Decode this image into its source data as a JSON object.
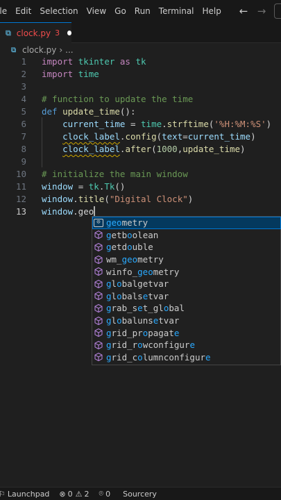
{
  "menu": [
    "File",
    "Edit",
    "Selection",
    "View",
    "Go",
    "Run",
    "Terminal",
    "Help"
  ],
  "nav": {
    "back_icon": "arrow-left-icon",
    "forward_icon": "arrow-right-icon"
  },
  "tab": {
    "filename": "clock.py",
    "problem_count": "3",
    "modified_icon": "unsaved-dot-icon"
  },
  "breadcrumb": {
    "file": "clock.py",
    "separator": "›",
    "more": "..."
  },
  "editor": {
    "line_numbers": [
      "1",
      "2",
      "3",
      "4",
      "5",
      "6",
      "7",
      "8",
      "9",
      "10",
      "11",
      "12",
      "13"
    ],
    "active_line": "13"
  },
  "suggest": {
    "items": [
      {
        "label": "geometry",
        "kind": "selected"
      },
      {
        "label": "getboolean",
        "kind": "method-icon"
      },
      {
        "label": "getdouble",
        "kind": "method-icon"
      },
      {
        "label": "wm_geometry",
        "kind": "method-icon"
      },
      {
        "label": "winfo_geometry",
        "kind": "method-icon"
      },
      {
        "label": "globalgetvar",
        "kind": "method-icon"
      },
      {
        "label": "globalsetvar",
        "kind": "method-icon"
      },
      {
        "label": "grab_set_global",
        "kind": "method-icon"
      },
      {
        "label": "globalunsetvar",
        "kind": "method-icon"
      },
      {
        "label": "grid_propagate",
        "kind": "method-icon"
      },
      {
        "label": "grid_rowconfigure",
        "kind": "method-icon"
      },
      {
        "label": "grid_columnconfigure",
        "kind": "method-icon"
      }
    ]
  },
  "status": {
    "launchpad": "Launchpad",
    "errors": "0",
    "warnings": "2",
    "ports": "0",
    "sourcery": "Sourcery"
  },
  "colors": {
    "accent": "#0078d4",
    "error": "#f14c4c",
    "match": "#2aaaff"
  }
}
